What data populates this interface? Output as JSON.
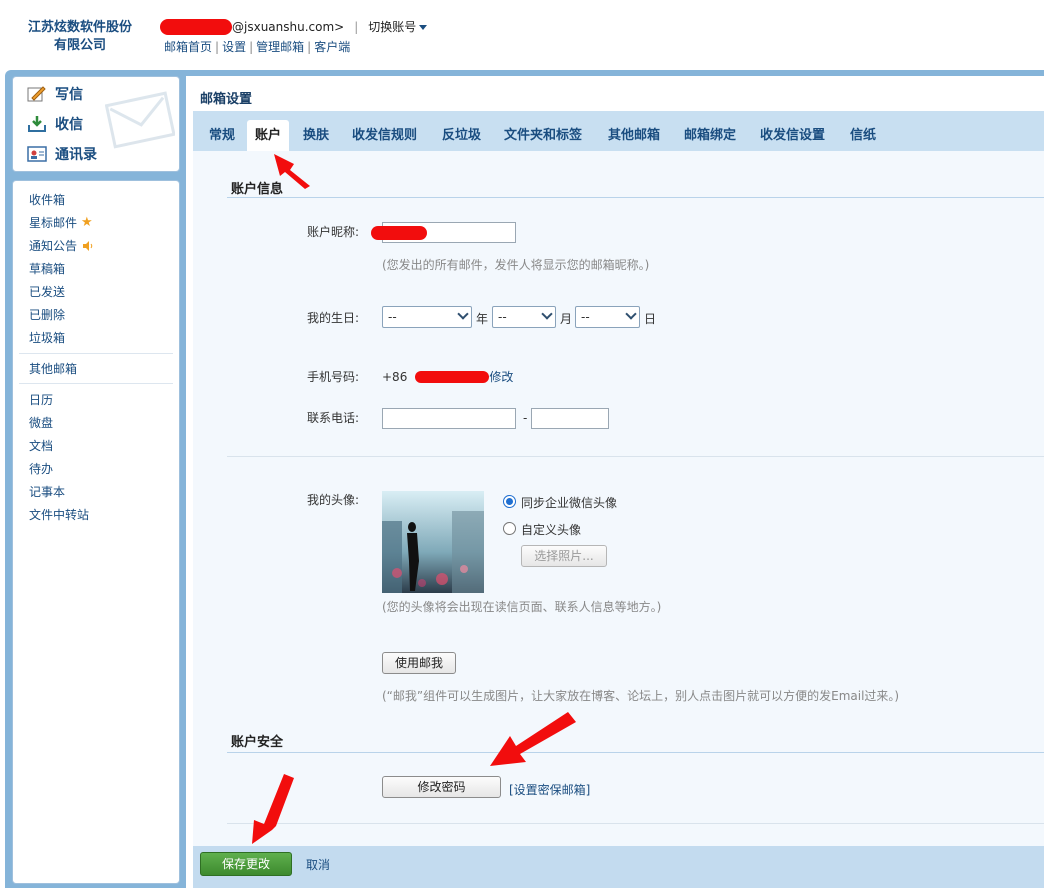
{
  "header": {
    "company_line1": "江苏炫数软件股份",
    "company_line2": "有限公司",
    "email_suffix": "@jsxuanshu.com>",
    "switch_account": "切换账号",
    "links": [
      "邮箱首页",
      "设置",
      "管理邮箱",
      "客户端"
    ],
    "link_sep": "|"
  },
  "sidebar": {
    "quick": [
      "写信",
      "收信",
      "通讯录"
    ],
    "folders": [
      "收件箱",
      "星标邮件",
      "通知公告",
      "草稿箱",
      "已发送",
      "已删除",
      "垃圾箱"
    ],
    "other": [
      "其他邮箱"
    ],
    "apps": [
      "日历",
      "微盘",
      "文档",
      "待办",
      "记事本",
      "文件中转站"
    ]
  },
  "main": {
    "title": "邮箱设置",
    "tabs": [
      {
        "label": "常规"
      },
      {
        "label": "账户",
        "active": true
      },
      {
        "label": "换肤"
      },
      {
        "label": "收发信规则"
      },
      {
        "label": "反垃圾"
      },
      {
        "label": "文件夹和标签"
      },
      {
        "label": "其他邮箱"
      },
      {
        "label": "邮箱绑定"
      },
      {
        "label": "收发信设置"
      },
      {
        "label": "信纸"
      }
    ]
  },
  "account": {
    "section_title": "账户信息",
    "nickname_label": "账户昵称:",
    "nickname_hint": "(您发出的所有邮件，发件人将显示您的邮箱昵称。)",
    "birthday_label": "我的生日:",
    "birthday_year": "--",
    "birthday_month": "--",
    "birthday_day": "--",
    "year_unit": "年",
    "month_unit": "月",
    "day_unit": "日",
    "phone_label": "手机号码:",
    "phone_prefix": "+86",
    "phone_modify": "修改",
    "tel_label": "联系电话:",
    "tel_dash": "-",
    "avatar_label": "我的头像:",
    "avatar_option_sync": "同步企业微信头像",
    "avatar_option_custom": "自定义头像",
    "choose_photo": "选择照片...",
    "avatar_hint": "(您的头像将会出现在读信页面、联系人信息等地方。)",
    "mail_me_button": "使用邮我",
    "mail_me_hint": "(“邮我”组件可以生成图片，让大家放在博客、论坛上，别人点击图片就可以方便的发Email过来。)"
  },
  "security": {
    "section_title": "账户安全",
    "change_password": "修改密码",
    "set_secure_email": "[设置密保邮箱]"
  },
  "footer": {
    "save": "保存更改",
    "cancel": "取消"
  },
  "colors": {
    "accent": "#1a4d80",
    "frame": "#85b4d9",
    "tabbar": "#c8dff1",
    "save_green": "#3d8a2e",
    "annotation_red": "#f20d0d"
  }
}
